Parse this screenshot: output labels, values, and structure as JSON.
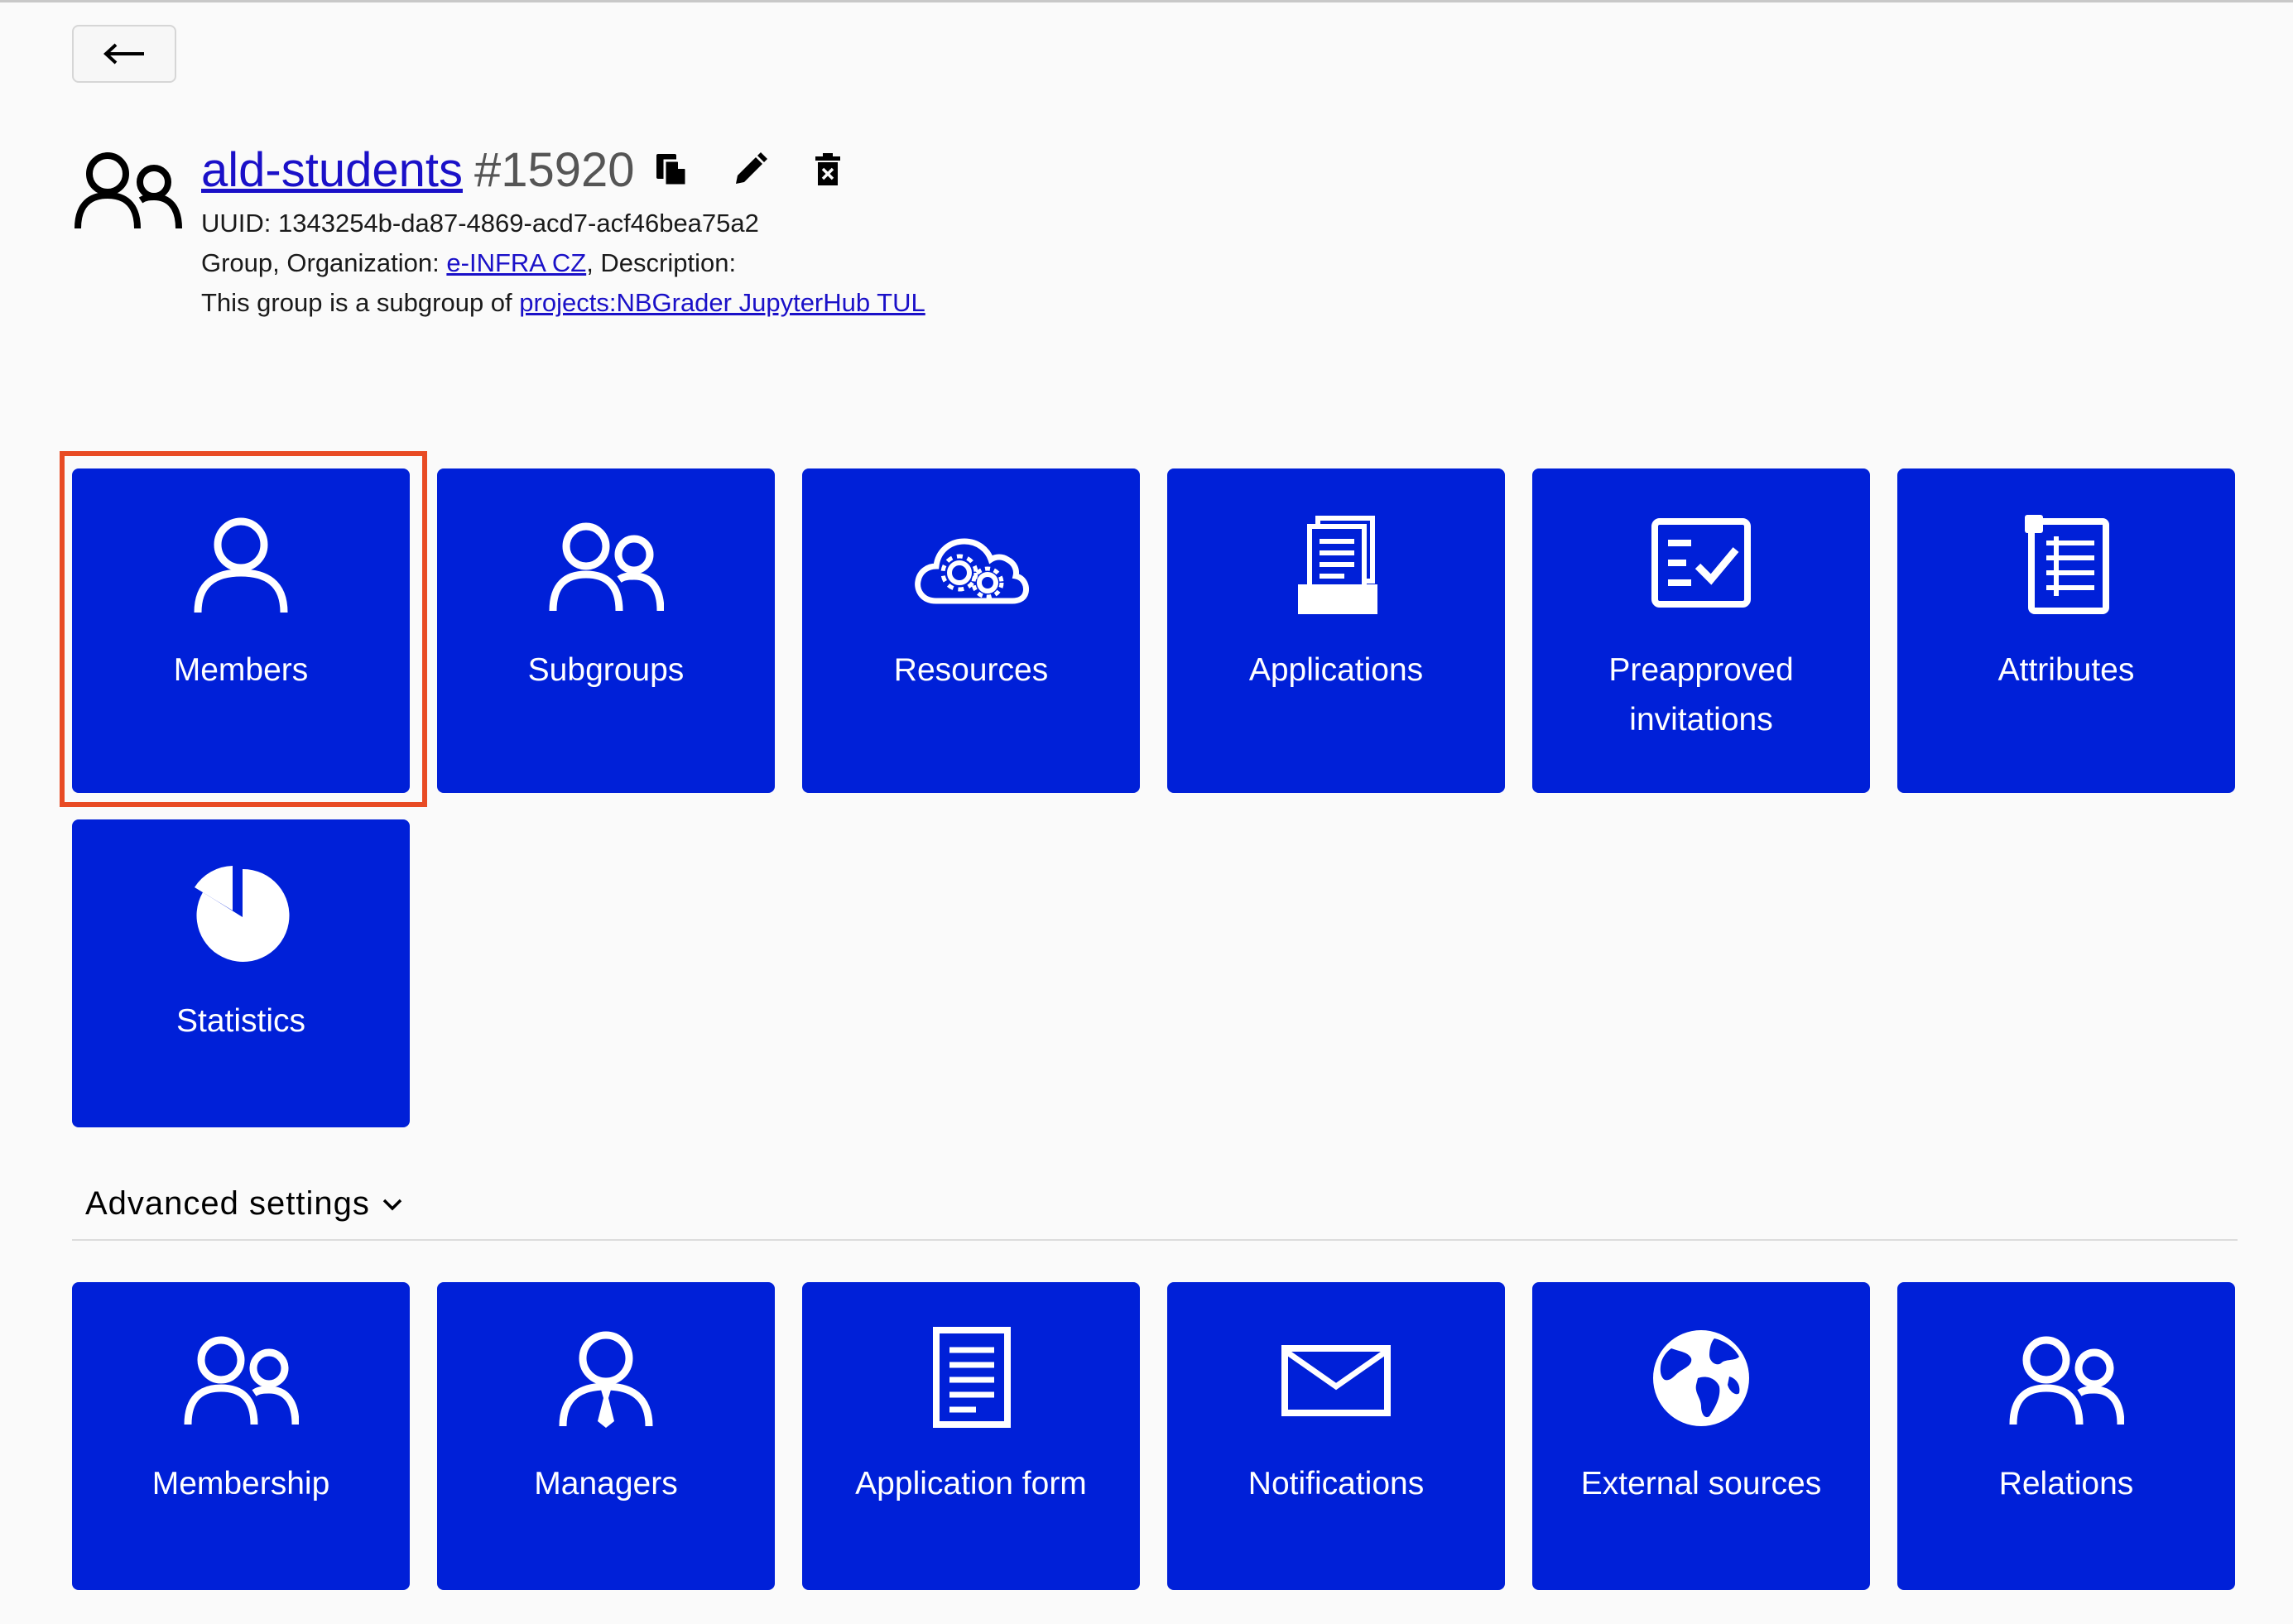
{
  "header": {
    "back_icon": "arrow-left-icon",
    "group_name": "ald-students",
    "group_id": "#15920",
    "actions": [
      "copy-icon",
      "edit-icon",
      "delete-icon"
    ],
    "uuid_line": "UUID: 1343254b-da87-4869-acd7-acf46bea75a2",
    "org_prefix": "Group, Organization: ",
    "org_link": "e-INFRA CZ",
    "org_suffix": ", Description:",
    "parent_prefix": "This group is a subgroup of ",
    "parent_link": "projects:NBGrader JupyterHub TUL"
  },
  "main_tiles": [
    {
      "label": "Members",
      "icon": "user-icon"
    },
    {
      "label": "Subgroups",
      "icon": "users-icon"
    },
    {
      "label": "Resources",
      "icon": "cloud-gears-icon"
    },
    {
      "label": "Applications",
      "icon": "document-stack-icon"
    },
    {
      "label": "Preapproved invitations",
      "icon": "checklist-icon"
    },
    {
      "label": "Attributes",
      "icon": "list-icon"
    },
    {
      "label": "Statistics",
      "icon": "pie-chart-icon"
    }
  ],
  "advanced": {
    "toggle_label": "Advanced settings",
    "tiles": [
      {
        "label": "Membership",
        "icon": "users-icon"
      },
      {
        "label": "Managers",
        "icon": "manager-icon"
      },
      {
        "label": "Application form",
        "icon": "document-icon"
      },
      {
        "label": "Notifications",
        "icon": "envelope-icon"
      },
      {
        "label": "External sources",
        "icon": "globe-icon"
      },
      {
        "label": "Relations",
        "icon": "users-icon"
      }
    ]
  },
  "colors": {
    "tile_bg": "#0020d8",
    "link": "#1a10c8",
    "highlight": "#e84b24"
  }
}
